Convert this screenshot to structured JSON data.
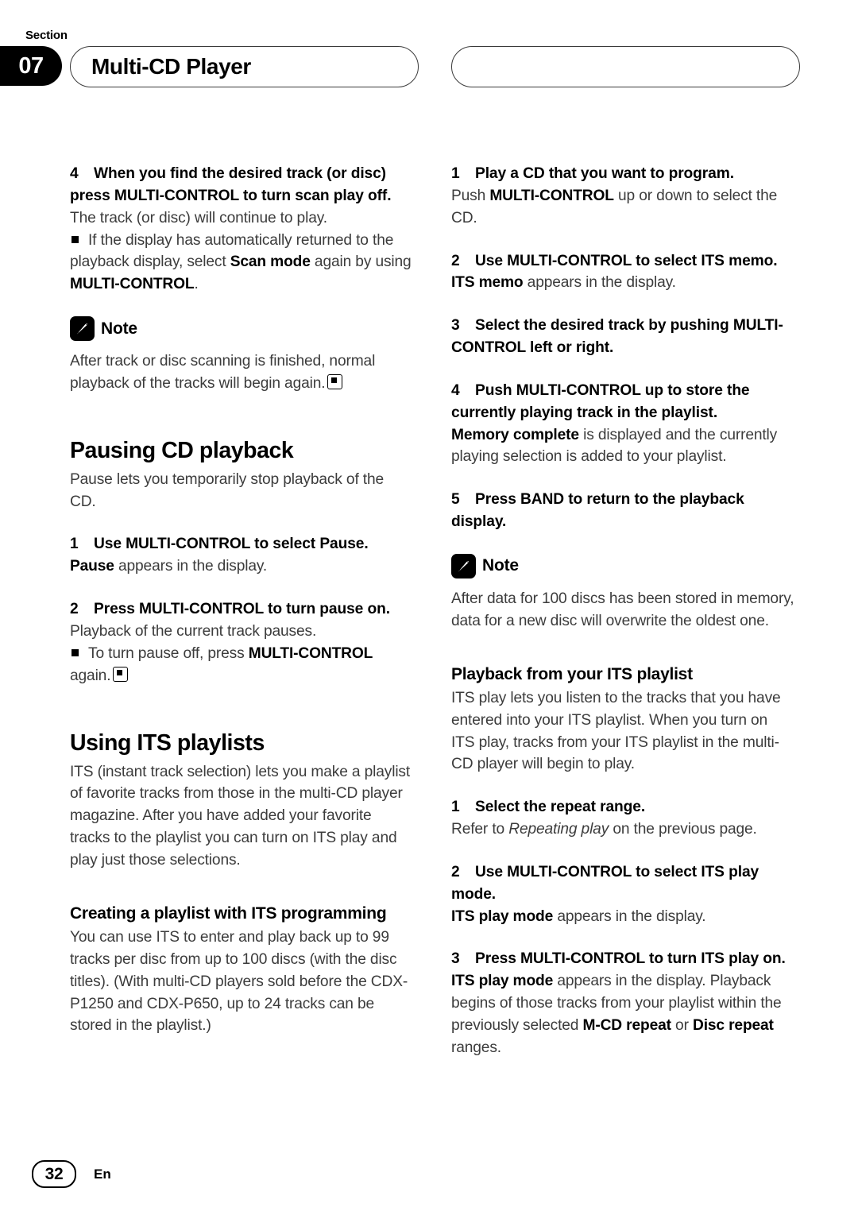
{
  "header": {
    "section_label": "Section",
    "section_number": "07",
    "title": "Multi-CD Player"
  },
  "footer": {
    "page_number": "32",
    "language": "En"
  },
  "note_label": "Note",
  "left_column": {
    "step4": {
      "num": "4",
      "text": "When you find the desired track (or disc) press MULTI-CONTROL to turn scan play off.",
      "body": "The track (or disc) will continue to play.",
      "bullet_pre": "If the display has automatically returned to the playback display, select ",
      "bullet_b1": "Scan mode",
      "bullet_mid": " again by using ",
      "bullet_b2": "MULTI-CONTROL",
      "bullet_post": "."
    },
    "note1": "After track or disc scanning is finished, normal playback of the tracks will begin again.",
    "pausing": {
      "heading": "Pausing CD playback",
      "intro": "Pause lets you temporarily stop playback of the CD.",
      "step1_num": "1",
      "step1": "Use MULTI-CONTROL to select Pause.",
      "step1_b": "Pause",
      "step1_rest": " appears in the display.",
      "step2_num": "2",
      "step2": "Press MULTI-CONTROL to turn pause on.",
      "step2_body": "Playback of the current track pauses.",
      "step2_bullet_pre": "To turn pause off, press ",
      "step2_bullet_b": "MULTI-CONTROL",
      "step2_bullet_post": " again."
    },
    "its": {
      "heading": "Using ITS playlists",
      "intro": "ITS (instant track selection) lets you make a playlist of favorite tracks from those in the multi-CD player magazine. After you have added your favorite tracks to the playlist you can turn on ITS play and play just those selections.",
      "sub_heading": "Creating a playlist with ITS programming",
      "sub_body": "You can use ITS to enter and play back up to 99 tracks per disc from up to 100 discs (with the disc titles). (With multi-CD players sold before the CDX-P1250 and CDX-P650, up to 24 tracks can be stored in the playlist.)"
    }
  },
  "right_column": {
    "step1_num": "1",
    "step1": "Play a CD that you want to program.",
    "step1_body_pre": "Push ",
    "step1_body_b": "MULTI-CONTROL",
    "step1_body_post": " up or down to select the CD.",
    "step2_num": "2",
    "step2": "Use MULTI-CONTROL to select ITS memo.",
    "step2_body_b": "ITS memo",
    "step2_body_post": " appears in the display.",
    "step3_num": "3",
    "step3": "Select the desired track by pushing MULTI-CONTROL left or right.",
    "step4_num": "4",
    "step4": "Push MULTI-CONTROL up to store the currently playing track in the playlist.",
    "step4_body_b": "Memory complete",
    "step4_body_post": " is displayed and the currently playing selection is added to your playlist.",
    "step5_num": "5",
    "step5": "Press BAND to return to the playback display.",
    "note2": "After data for 100 discs has been stored in memory, data for a new disc will overwrite the oldest one.",
    "playback": {
      "heading": "Playback from your ITS playlist",
      "intro": "ITS play lets you listen to the tracks that you have entered into your ITS playlist. When you turn on ITS play, tracks from your ITS playlist in the multi-CD player will begin to play.",
      "p1_num": "1",
      "p1": "Select the repeat range.",
      "p1_body_pre": "Refer to ",
      "p1_body_i": "Repeating play",
      "p1_body_post": " on the previous page.",
      "p2_num": "2",
      "p2": "Use MULTI-CONTROL to select ITS play mode.",
      "p2_body_b": "ITS play mode",
      "p2_body_post": " appears in the display.",
      "p3_num": "3",
      "p3": "Press MULTI-CONTROL to turn ITS play on.",
      "p3_body_b1": "ITS play mode",
      "p3_body_mid": " appears in the display. Playback begins of those tracks from your playlist within the previously selected ",
      "p3_body_b2": "M-CD repeat",
      "p3_body_mid2": " or ",
      "p3_body_b3": "Disc repeat",
      "p3_body_post": " ranges."
    }
  }
}
